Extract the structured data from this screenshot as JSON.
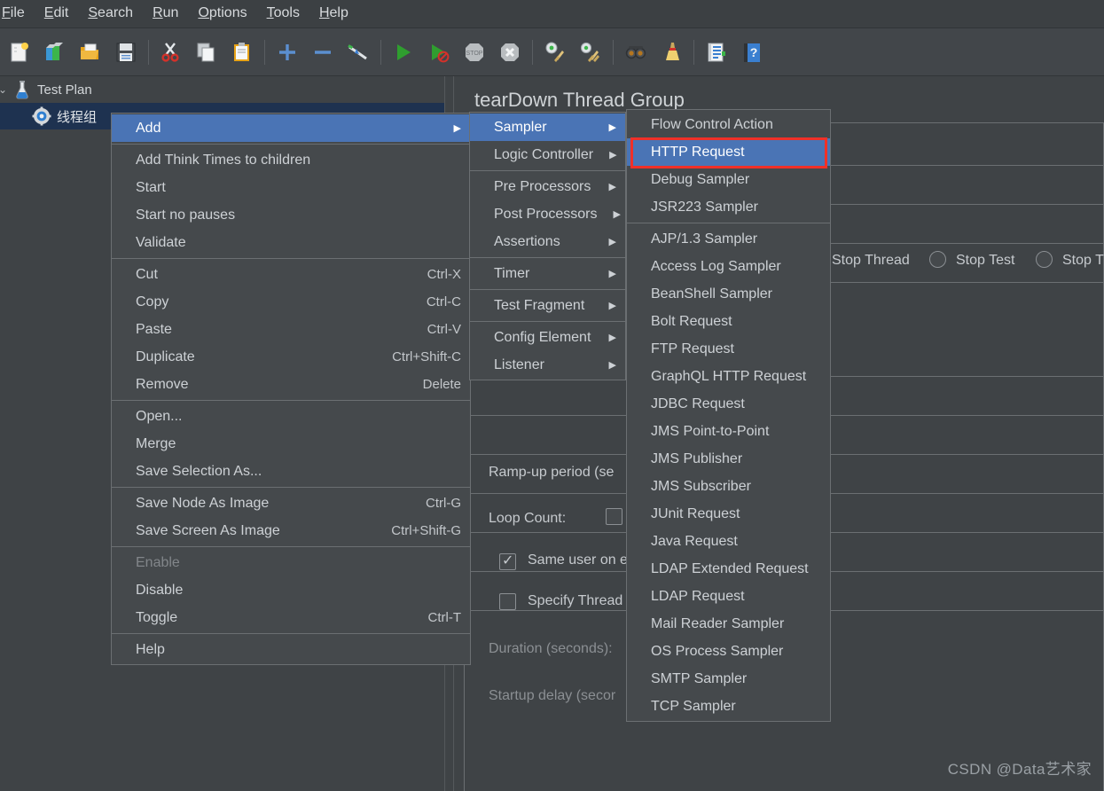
{
  "menubar": {
    "items": [
      {
        "label": "File",
        "accel": "F"
      },
      {
        "label": "Edit",
        "accel": "E"
      },
      {
        "label": "Search",
        "accel": "S"
      },
      {
        "label": "Run",
        "accel": "R"
      },
      {
        "label": "Options",
        "accel": "O"
      },
      {
        "label": "Tools",
        "accel": "T"
      },
      {
        "label": "Help",
        "accel": "H"
      }
    ]
  },
  "toolbar": {
    "buttons": [
      {
        "name": "new-icon",
        "tip": "New"
      },
      {
        "name": "templates-icon",
        "tip": "Templates"
      },
      {
        "name": "open-icon",
        "tip": "Open"
      },
      {
        "name": "save-icon",
        "tip": "Save Test Plan"
      },
      {
        "name": "cut-icon",
        "tip": "Cut"
      },
      {
        "name": "copy-icon",
        "tip": "Copy"
      },
      {
        "name": "paste-icon",
        "tip": "Paste"
      },
      {
        "name": "expand-all-icon",
        "tip": "Expand All"
      },
      {
        "name": "collapse-all-icon",
        "tip": "Collapse All"
      },
      {
        "name": "toggle-icon",
        "tip": "Toggle"
      },
      {
        "name": "start-icon",
        "tip": "Start"
      },
      {
        "name": "start-no-pauses-icon",
        "tip": "Start no pauses"
      },
      {
        "name": "stop-icon",
        "tip": "Stop"
      },
      {
        "name": "shutdown-icon",
        "tip": "Shutdown"
      },
      {
        "name": "clear-icon",
        "tip": "Clear"
      },
      {
        "name": "clear-all-icon",
        "tip": "Clear All"
      },
      {
        "name": "search-icon",
        "tip": "Search"
      },
      {
        "name": "reset-search-icon",
        "tip": "Reset Search"
      },
      {
        "name": "function-helper-icon",
        "tip": "Function Helper Dialog"
      },
      {
        "name": "help-icon",
        "tip": "Help"
      }
    ]
  },
  "tree": {
    "nodes": [
      {
        "label": "Test Plan",
        "icon": "test-plan-icon",
        "selected": false
      },
      {
        "label": "线程组",
        "icon": "thread-group-icon",
        "selected": true
      }
    ]
  },
  "right_panel": {
    "title": "tearDown Thread Group",
    "fields": {
      "ramp_up": "Ramp-up period (se",
      "loop_count": "Loop Count:",
      "same_user": "Same user on e",
      "specify_thread": "Specify Thread",
      "duration": "Duration (seconds):",
      "startup_delay": "Startup delay (secor"
    },
    "action_radios": [
      {
        "label": "Stop Thread"
      },
      {
        "label": "Stop Test"
      },
      {
        "label": "Stop T"
      }
    ]
  },
  "context_menu": {
    "groups": [
      [
        {
          "label": "Add",
          "submenu": true,
          "selected": true
        }
      ],
      [
        {
          "label": "Add Think Times to children"
        },
        {
          "label": "Start"
        },
        {
          "label": "Start no pauses"
        },
        {
          "label": "Validate"
        }
      ],
      [
        {
          "label": "Cut",
          "shortcut": "Ctrl-X"
        },
        {
          "label": "Copy",
          "shortcut": "Ctrl-C"
        },
        {
          "label": "Paste",
          "shortcut": "Ctrl-V"
        },
        {
          "label": "Duplicate",
          "shortcut": "Ctrl+Shift-C"
        },
        {
          "label": "Remove",
          "shortcut": "Delete"
        }
      ],
      [
        {
          "label": "Open..."
        },
        {
          "label": "Merge"
        },
        {
          "label": "Save Selection As..."
        }
      ],
      [
        {
          "label": "Save Node As Image",
          "shortcut": "Ctrl-G"
        },
        {
          "label": "Save Screen As Image",
          "shortcut": "Ctrl+Shift-G"
        }
      ],
      [
        {
          "label": "Enable",
          "disabled": true
        },
        {
          "label": "Disable"
        },
        {
          "label": "Toggle",
          "shortcut": "Ctrl-T"
        }
      ],
      [
        {
          "label": "Help"
        }
      ]
    ]
  },
  "add_submenu": {
    "groups": [
      [
        {
          "label": "Sampler",
          "submenu": true,
          "selected": true
        },
        {
          "label": "Logic Controller",
          "submenu": true
        }
      ],
      [
        {
          "label": "Pre Processors",
          "submenu": true
        },
        {
          "label": "Post Processors",
          "submenu": true
        },
        {
          "label": "Assertions",
          "submenu": true
        }
      ],
      [
        {
          "label": "Timer",
          "submenu": true
        }
      ],
      [
        {
          "label": "Test Fragment",
          "submenu": true
        }
      ],
      [
        {
          "label": "Config Element",
          "submenu": true
        },
        {
          "label": "Listener",
          "submenu": true
        }
      ]
    ]
  },
  "sampler_submenu": {
    "groups": [
      [
        {
          "label": "Flow Control Action"
        },
        {
          "label": "HTTP Request",
          "selected": true,
          "highlighted": true
        },
        {
          "label": "Debug Sampler"
        },
        {
          "label": "JSR223 Sampler"
        }
      ],
      [
        {
          "label": "AJP/1.3 Sampler"
        },
        {
          "label": "Access Log Sampler"
        },
        {
          "label": "BeanShell Sampler"
        },
        {
          "label": "Bolt Request"
        },
        {
          "label": "FTP Request"
        },
        {
          "label": "GraphQL HTTP Request"
        },
        {
          "label": "JDBC Request"
        },
        {
          "label": "JMS Point-to-Point"
        },
        {
          "label": "JMS Publisher"
        },
        {
          "label": "JMS Subscriber"
        },
        {
          "label": "JUnit Request"
        },
        {
          "label": "Java Request"
        },
        {
          "label": "LDAP Extended Request"
        },
        {
          "label": "LDAP Request"
        },
        {
          "label": "Mail Reader Sampler"
        },
        {
          "label": "OS Process Sampler"
        },
        {
          "label": "SMTP Sampler"
        },
        {
          "label": "TCP Sampler"
        }
      ]
    ]
  },
  "annotation": {
    "highlight_color": "#f03028",
    "target": "HTTP Request"
  },
  "watermark": "CSDN @Data艺术家",
  "colors": {
    "window_bg": "#3f4346",
    "menu_bg": "#45494c",
    "menu_selected": "#4a74b5",
    "tree_selected": "#1e3250",
    "text": "#cdd1d5",
    "text_disabled": "#82868a",
    "border": "#6b6f72"
  }
}
